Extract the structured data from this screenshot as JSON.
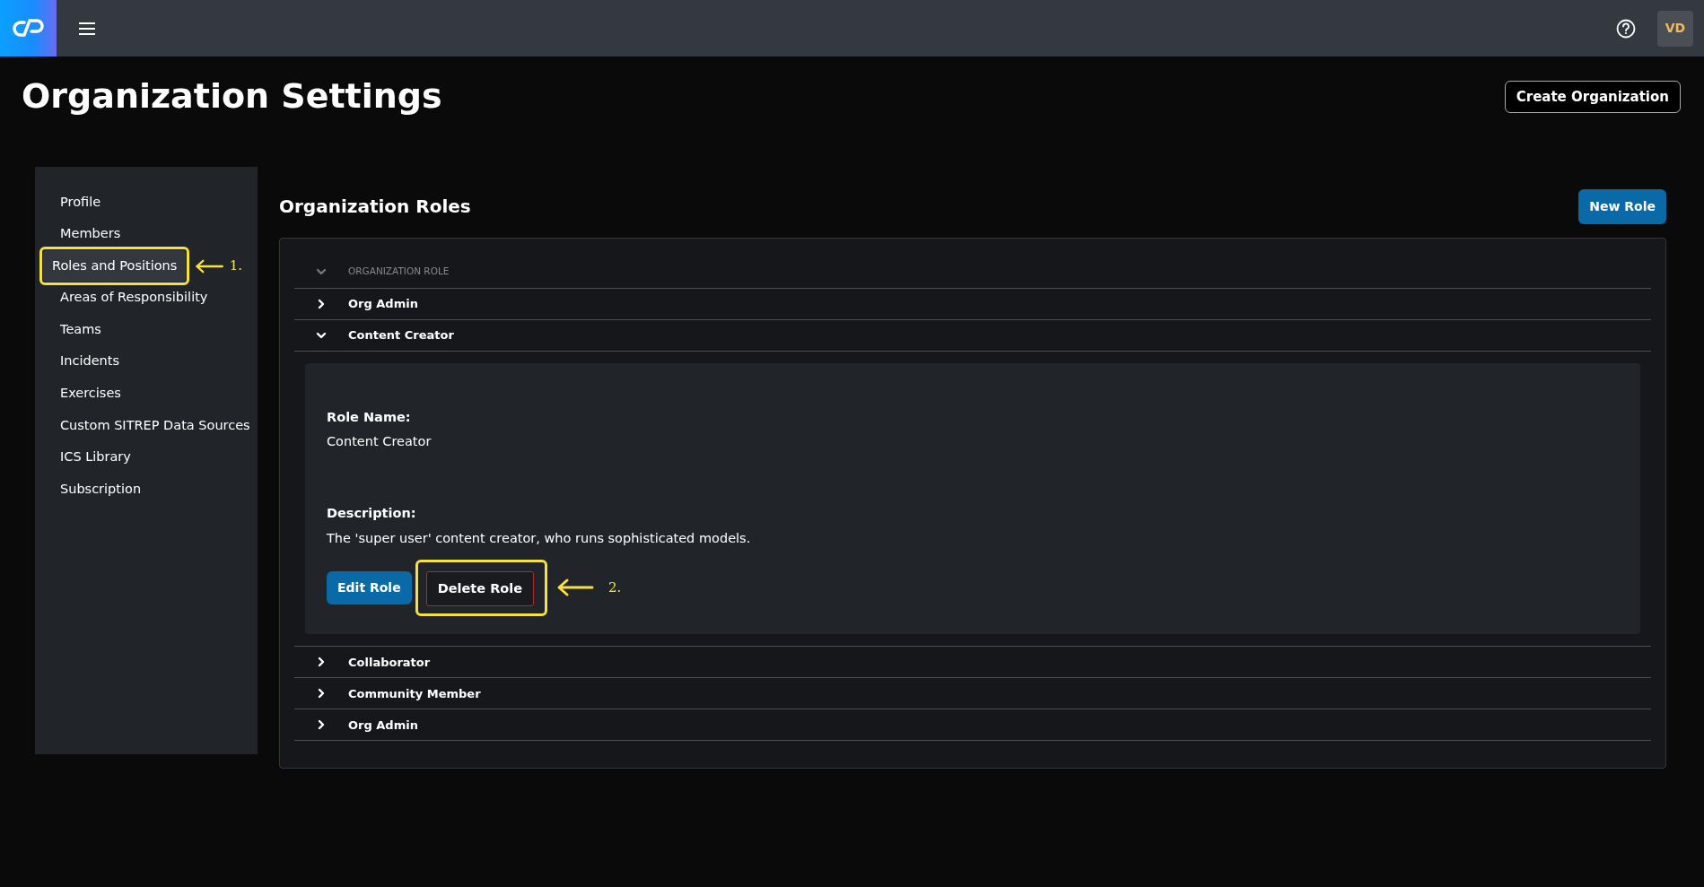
{
  "topbar": {
    "avatar": "VD"
  },
  "page_title": "Organization Settings",
  "create_button": "Create Organization",
  "sidebar": {
    "items": [
      {
        "label": "Profile",
        "selected": false
      },
      {
        "label": "Members",
        "selected": false
      },
      {
        "label": "Roles and Positions",
        "selected": true,
        "callout": "1."
      },
      {
        "label": "Areas of Responsibility",
        "selected": false
      },
      {
        "label": "Teams",
        "selected": false
      },
      {
        "label": "Incidents",
        "selected": false
      },
      {
        "label": "Exercises",
        "selected": false
      },
      {
        "label": "Custom SITREP Data Sources",
        "selected": false
      },
      {
        "label": "ICS Library",
        "selected": false
      },
      {
        "label": "Subscription",
        "selected": false
      }
    ]
  },
  "section_title": "Organization Roles",
  "new_button": "New Role",
  "table": {
    "columns": [
      "ORGANIZATION ROLE"
    ],
    "rows": [
      {
        "name": "Org Admin",
        "expanded": false
      },
      {
        "name": "Content Creator",
        "expanded": true,
        "details": {
          "name_label": "Role Name:",
          "name_value": "Content Creator",
          "description_label": "Description:",
          "description_value": "The 'super user' content creator, who runs sophisticated models.",
          "edit_button": "Edit Role",
          "delete_button": "Delete Role",
          "delete_callout": "2."
        }
      },
      {
        "name": "Collaborator",
        "expanded": false
      },
      {
        "name": "Community Member",
        "expanded": false
      },
      {
        "name": "Org Admin",
        "expanded": false
      }
    ]
  }
}
